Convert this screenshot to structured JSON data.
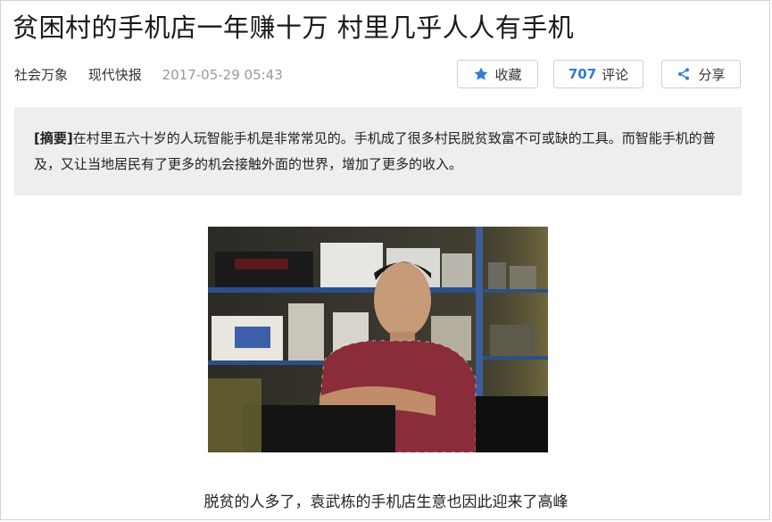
{
  "article": {
    "title": "贫困村的手机店一年赚十万 村里几乎人人有手机",
    "category": "社会万象",
    "source": "现代快报",
    "time": "2017-05-29 05:43"
  },
  "actions": {
    "favorite_label": "收藏",
    "favorite_icon": "star-icon",
    "comment_count": "707",
    "comment_label": "评论",
    "share_label": "分享",
    "share_icon": "share-icon",
    "accent": "#2f7bd6"
  },
  "summary": {
    "tag": "[摘要]",
    "text": "在村里五六十岁的人玩智能手机是非常常见的。手机成了很多村民脱贫致富不可或缺的工具。而智能手机的普及，又让当地居民有了更多的机会接触外面的世界，增加了更多的收入。"
  },
  "photo": {
    "caption": "脱贫的人多了，袁武栋的手机店生意也因此迎来了高峰"
  }
}
